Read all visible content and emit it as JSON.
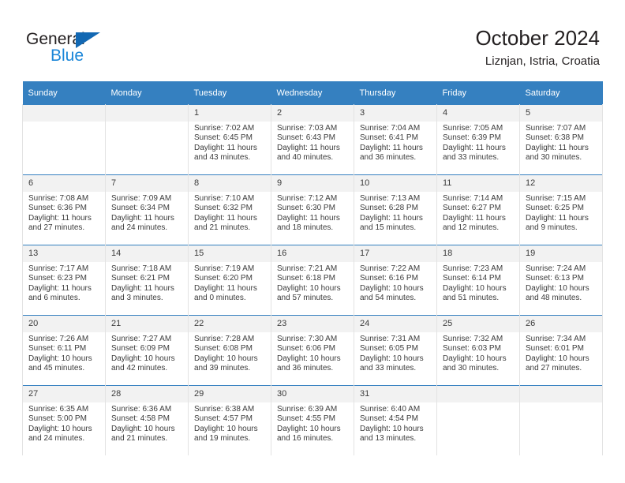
{
  "brand": {
    "name_top": "General",
    "name_bottom": "Blue",
    "triangle_color": "#1268b3",
    "blue_color": "#1b86d8",
    "dark_color": "#231f20"
  },
  "header": {
    "title": "October 2024",
    "location": "Liznjan, Istria, Croatia"
  },
  "theme": {
    "header_bg": "#3580c0",
    "header_text": "#ffffff",
    "daynum_bg": "#f2f2f2",
    "cell_border": "#e3e3e3",
    "row_border": "#3580c0",
    "text": "#3b3b3b"
  },
  "weekdays": [
    "Sunday",
    "Monday",
    "Tuesday",
    "Wednesday",
    "Thursday",
    "Friday",
    "Saturday"
  ],
  "labels": {
    "sunrise": "Sunrise:",
    "sunset": "Sunset:",
    "daylight": "Daylight:"
  },
  "weeks": [
    [
      {
        "day": "",
        "sunrise": "",
        "sunset": "",
        "daylight": ""
      },
      {
        "day": "",
        "sunrise": "",
        "sunset": "",
        "daylight": ""
      },
      {
        "day": "1",
        "sunrise": "Sunrise: 7:02 AM",
        "sunset": "Sunset: 6:45 PM",
        "daylight": "Daylight: 11 hours and 43 minutes."
      },
      {
        "day": "2",
        "sunrise": "Sunrise: 7:03 AM",
        "sunset": "Sunset: 6:43 PM",
        "daylight": "Daylight: 11 hours and 40 minutes."
      },
      {
        "day": "3",
        "sunrise": "Sunrise: 7:04 AM",
        "sunset": "Sunset: 6:41 PM",
        "daylight": "Daylight: 11 hours and 36 minutes."
      },
      {
        "day": "4",
        "sunrise": "Sunrise: 7:05 AM",
        "sunset": "Sunset: 6:39 PM",
        "daylight": "Daylight: 11 hours and 33 minutes."
      },
      {
        "day": "5",
        "sunrise": "Sunrise: 7:07 AM",
        "sunset": "Sunset: 6:38 PM",
        "daylight": "Daylight: 11 hours and 30 minutes."
      }
    ],
    [
      {
        "day": "6",
        "sunrise": "Sunrise: 7:08 AM",
        "sunset": "Sunset: 6:36 PM",
        "daylight": "Daylight: 11 hours and 27 minutes."
      },
      {
        "day": "7",
        "sunrise": "Sunrise: 7:09 AM",
        "sunset": "Sunset: 6:34 PM",
        "daylight": "Daylight: 11 hours and 24 minutes."
      },
      {
        "day": "8",
        "sunrise": "Sunrise: 7:10 AM",
        "sunset": "Sunset: 6:32 PM",
        "daylight": "Daylight: 11 hours and 21 minutes."
      },
      {
        "day": "9",
        "sunrise": "Sunrise: 7:12 AM",
        "sunset": "Sunset: 6:30 PM",
        "daylight": "Daylight: 11 hours and 18 minutes."
      },
      {
        "day": "10",
        "sunrise": "Sunrise: 7:13 AM",
        "sunset": "Sunset: 6:28 PM",
        "daylight": "Daylight: 11 hours and 15 minutes."
      },
      {
        "day": "11",
        "sunrise": "Sunrise: 7:14 AM",
        "sunset": "Sunset: 6:27 PM",
        "daylight": "Daylight: 11 hours and 12 minutes."
      },
      {
        "day": "12",
        "sunrise": "Sunrise: 7:15 AM",
        "sunset": "Sunset: 6:25 PM",
        "daylight": "Daylight: 11 hours and 9 minutes."
      }
    ],
    [
      {
        "day": "13",
        "sunrise": "Sunrise: 7:17 AM",
        "sunset": "Sunset: 6:23 PM",
        "daylight": "Daylight: 11 hours and 6 minutes."
      },
      {
        "day": "14",
        "sunrise": "Sunrise: 7:18 AM",
        "sunset": "Sunset: 6:21 PM",
        "daylight": "Daylight: 11 hours and 3 minutes."
      },
      {
        "day": "15",
        "sunrise": "Sunrise: 7:19 AM",
        "sunset": "Sunset: 6:20 PM",
        "daylight": "Daylight: 11 hours and 0 minutes."
      },
      {
        "day": "16",
        "sunrise": "Sunrise: 7:21 AM",
        "sunset": "Sunset: 6:18 PM",
        "daylight": "Daylight: 10 hours and 57 minutes."
      },
      {
        "day": "17",
        "sunrise": "Sunrise: 7:22 AM",
        "sunset": "Sunset: 6:16 PM",
        "daylight": "Daylight: 10 hours and 54 minutes."
      },
      {
        "day": "18",
        "sunrise": "Sunrise: 7:23 AM",
        "sunset": "Sunset: 6:14 PM",
        "daylight": "Daylight: 10 hours and 51 minutes."
      },
      {
        "day": "19",
        "sunrise": "Sunrise: 7:24 AM",
        "sunset": "Sunset: 6:13 PM",
        "daylight": "Daylight: 10 hours and 48 minutes."
      }
    ],
    [
      {
        "day": "20",
        "sunrise": "Sunrise: 7:26 AM",
        "sunset": "Sunset: 6:11 PM",
        "daylight": "Daylight: 10 hours and 45 minutes."
      },
      {
        "day": "21",
        "sunrise": "Sunrise: 7:27 AM",
        "sunset": "Sunset: 6:09 PM",
        "daylight": "Daylight: 10 hours and 42 minutes."
      },
      {
        "day": "22",
        "sunrise": "Sunrise: 7:28 AM",
        "sunset": "Sunset: 6:08 PM",
        "daylight": "Daylight: 10 hours and 39 minutes."
      },
      {
        "day": "23",
        "sunrise": "Sunrise: 7:30 AM",
        "sunset": "Sunset: 6:06 PM",
        "daylight": "Daylight: 10 hours and 36 minutes."
      },
      {
        "day": "24",
        "sunrise": "Sunrise: 7:31 AM",
        "sunset": "Sunset: 6:05 PM",
        "daylight": "Daylight: 10 hours and 33 minutes."
      },
      {
        "day": "25",
        "sunrise": "Sunrise: 7:32 AM",
        "sunset": "Sunset: 6:03 PM",
        "daylight": "Daylight: 10 hours and 30 minutes."
      },
      {
        "day": "26",
        "sunrise": "Sunrise: 7:34 AM",
        "sunset": "Sunset: 6:01 PM",
        "daylight": "Daylight: 10 hours and 27 minutes."
      }
    ],
    [
      {
        "day": "27",
        "sunrise": "Sunrise: 6:35 AM",
        "sunset": "Sunset: 5:00 PM",
        "daylight": "Daylight: 10 hours and 24 minutes."
      },
      {
        "day": "28",
        "sunrise": "Sunrise: 6:36 AM",
        "sunset": "Sunset: 4:58 PM",
        "daylight": "Daylight: 10 hours and 21 minutes."
      },
      {
        "day": "29",
        "sunrise": "Sunrise: 6:38 AM",
        "sunset": "Sunset: 4:57 PM",
        "daylight": "Daylight: 10 hours and 19 minutes."
      },
      {
        "day": "30",
        "sunrise": "Sunrise: 6:39 AM",
        "sunset": "Sunset: 4:55 PM",
        "daylight": "Daylight: 10 hours and 16 minutes."
      },
      {
        "day": "31",
        "sunrise": "Sunrise: 6:40 AM",
        "sunset": "Sunset: 4:54 PM",
        "daylight": "Daylight: 10 hours and 13 minutes."
      },
      {
        "day": "",
        "sunrise": "",
        "sunset": "",
        "daylight": ""
      },
      {
        "day": "",
        "sunrise": "",
        "sunset": "",
        "daylight": ""
      }
    ]
  ]
}
